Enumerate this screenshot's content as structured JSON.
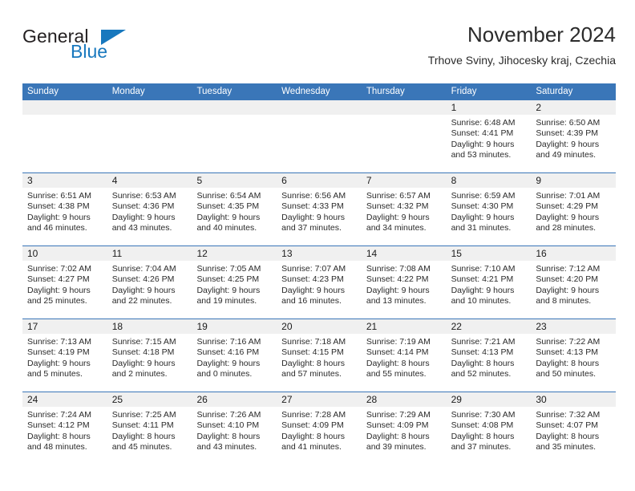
{
  "logo": {
    "word_one": "General",
    "word_two": "Blue",
    "triangle_icon": "triangle-icon",
    "accent_color": "#1878be"
  },
  "header": {
    "title": "November 2024",
    "subtitle": "Trhove Sviny, Jihocesky kraj, Czechia"
  },
  "theme": {
    "header_blue": "#3a76b8",
    "daynum_band": "#f0f0f0",
    "text": "#2a2a2a"
  },
  "calendar": {
    "weekday_headers": [
      "Sunday",
      "Monday",
      "Tuesday",
      "Wednesday",
      "Thursday",
      "Friday",
      "Saturday"
    ],
    "weeks": [
      [
        {
          "day": "",
          "empty": true
        },
        {
          "day": "",
          "empty": true
        },
        {
          "day": "",
          "empty": true
        },
        {
          "day": "",
          "empty": true
        },
        {
          "day": "",
          "empty": true
        },
        {
          "day": "1",
          "sunrise": "Sunrise: 6:48 AM",
          "sunset": "Sunset: 4:41 PM",
          "daylight1": "Daylight: 9 hours",
          "daylight2": "and 53 minutes."
        },
        {
          "day": "2",
          "sunrise": "Sunrise: 6:50 AM",
          "sunset": "Sunset: 4:39 PM",
          "daylight1": "Daylight: 9 hours",
          "daylight2": "and 49 minutes."
        }
      ],
      [
        {
          "day": "3",
          "sunrise": "Sunrise: 6:51 AM",
          "sunset": "Sunset: 4:38 PM",
          "daylight1": "Daylight: 9 hours",
          "daylight2": "and 46 minutes."
        },
        {
          "day": "4",
          "sunrise": "Sunrise: 6:53 AM",
          "sunset": "Sunset: 4:36 PM",
          "daylight1": "Daylight: 9 hours",
          "daylight2": "and 43 minutes."
        },
        {
          "day": "5",
          "sunrise": "Sunrise: 6:54 AM",
          "sunset": "Sunset: 4:35 PM",
          "daylight1": "Daylight: 9 hours",
          "daylight2": "and 40 minutes."
        },
        {
          "day": "6",
          "sunrise": "Sunrise: 6:56 AM",
          "sunset": "Sunset: 4:33 PM",
          "daylight1": "Daylight: 9 hours",
          "daylight2": "and 37 minutes."
        },
        {
          "day": "7",
          "sunrise": "Sunrise: 6:57 AM",
          "sunset": "Sunset: 4:32 PM",
          "daylight1": "Daylight: 9 hours",
          "daylight2": "and 34 minutes."
        },
        {
          "day": "8",
          "sunrise": "Sunrise: 6:59 AM",
          "sunset": "Sunset: 4:30 PM",
          "daylight1": "Daylight: 9 hours",
          "daylight2": "and 31 minutes."
        },
        {
          "day": "9",
          "sunrise": "Sunrise: 7:01 AM",
          "sunset": "Sunset: 4:29 PM",
          "daylight1": "Daylight: 9 hours",
          "daylight2": "and 28 minutes."
        }
      ],
      [
        {
          "day": "10",
          "sunrise": "Sunrise: 7:02 AM",
          "sunset": "Sunset: 4:27 PM",
          "daylight1": "Daylight: 9 hours",
          "daylight2": "and 25 minutes."
        },
        {
          "day": "11",
          "sunrise": "Sunrise: 7:04 AM",
          "sunset": "Sunset: 4:26 PM",
          "daylight1": "Daylight: 9 hours",
          "daylight2": "and 22 minutes."
        },
        {
          "day": "12",
          "sunrise": "Sunrise: 7:05 AM",
          "sunset": "Sunset: 4:25 PM",
          "daylight1": "Daylight: 9 hours",
          "daylight2": "and 19 minutes."
        },
        {
          "day": "13",
          "sunrise": "Sunrise: 7:07 AM",
          "sunset": "Sunset: 4:23 PM",
          "daylight1": "Daylight: 9 hours",
          "daylight2": "and 16 minutes."
        },
        {
          "day": "14",
          "sunrise": "Sunrise: 7:08 AM",
          "sunset": "Sunset: 4:22 PM",
          "daylight1": "Daylight: 9 hours",
          "daylight2": "and 13 minutes."
        },
        {
          "day": "15",
          "sunrise": "Sunrise: 7:10 AM",
          "sunset": "Sunset: 4:21 PM",
          "daylight1": "Daylight: 9 hours",
          "daylight2": "and 10 minutes."
        },
        {
          "day": "16",
          "sunrise": "Sunrise: 7:12 AM",
          "sunset": "Sunset: 4:20 PM",
          "daylight1": "Daylight: 9 hours",
          "daylight2": "and 8 minutes."
        }
      ],
      [
        {
          "day": "17",
          "sunrise": "Sunrise: 7:13 AM",
          "sunset": "Sunset: 4:19 PM",
          "daylight1": "Daylight: 9 hours",
          "daylight2": "and 5 minutes."
        },
        {
          "day": "18",
          "sunrise": "Sunrise: 7:15 AM",
          "sunset": "Sunset: 4:18 PM",
          "daylight1": "Daylight: 9 hours",
          "daylight2": "and 2 minutes."
        },
        {
          "day": "19",
          "sunrise": "Sunrise: 7:16 AM",
          "sunset": "Sunset: 4:16 PM",
          "daylight1": "Daylight: 9 hours",
          "daylight2": "and 0 minutes."
        },
        {
          "day": "20",
          "sunrise": "Sunrise: 7:18 AM",
          "sunset": "Sunset: 4:15 PM",
          "daylight1": "Daylight: 8 hours",
          "daylight2": "and 57 minutes."
        },
        {
          "day": "21",
          "sunrise": "Sunrise: 7:19 AM",
          "sunset": "Sunset: 4:14 PM",
          "daylight1": "Daylight: 8 hours",
          "daylight2": "and 55 minutes."
        },
        {
          "day": "22",
          "sunrise": "Sunrise: 7:21 AM",
          "sunset": "Sunset: 4:13 PM",
          "daylight1": "Daylight: 8 hours",
          "daylight2": "and 52 minutes."
        },
        {
          "day": "23",
          "sunrise": "Sunrise: 7:22 AM",
          "sunset": "Sunset: 4:13 PM",
          "daylight1": "Daylight: 8 hours",
          "daylight2": "and 50 minutes."
        }
      ],
      [
        {
          "day": "24",
          "sunrise": "Sunrise: 7:24 AM",
          "sunset": "Sunset: 4:12 PM",
          "daylight1": "Daylight: 8 hours",
          "daylight2": "and 48 minutes."
        },
        {
          "day": "25",
          "sunrise": "Sunrise: 7:25 AM",
          "sunset": "Sunset: 4:11 PM",
          "daylight1": "Daylight: 8 hours",
          "daylight2": "and 45 minutes."
        },
        {
          "day": "26",
          "sunrise": "Sunrise: 7:26 AM",
          "sunset": "Sunset: 4:10 PM",
          "daylight1": "Daylight: 8 hours",
          "daylight2": "and 43 minutes."
        },
        {
          "day": "27",
          "sunrise": "Sunrise: 7:28 AM",
          "sunset": "Sunset: 4:09 PM",
          "daylight1": "Daylight: 8 hours",
          "daylight2": "and 41 minutes."
        },
        {
          "day": "28",
          "sunrise": "Sunrise: 7:29 AM",
          "sunset": "Sunset: 4:09 PM",
          "daylight1": "Daylight: 8 hours",
          "daylight2": "and 39 minutes."
        },
        {
          "day": "29",
          "sunrise": "Sunrise: 7:30 AM",
          "sunset": "Sunset: 4:08 PM",
          "daylight1": "Daylight: 8 hours",
          "daylight2": "and 37 minutes."
        },
        {
          "day": "30",
          "sunrise": "Sunrise: 7:32 AM",
          "sunset": "Sunset: 4:07 PM",
          "daylight1": "Daylight: 8 hours",
          "daylight2": "and 35 minutes."
        }
      ]
    ]
  }
}
